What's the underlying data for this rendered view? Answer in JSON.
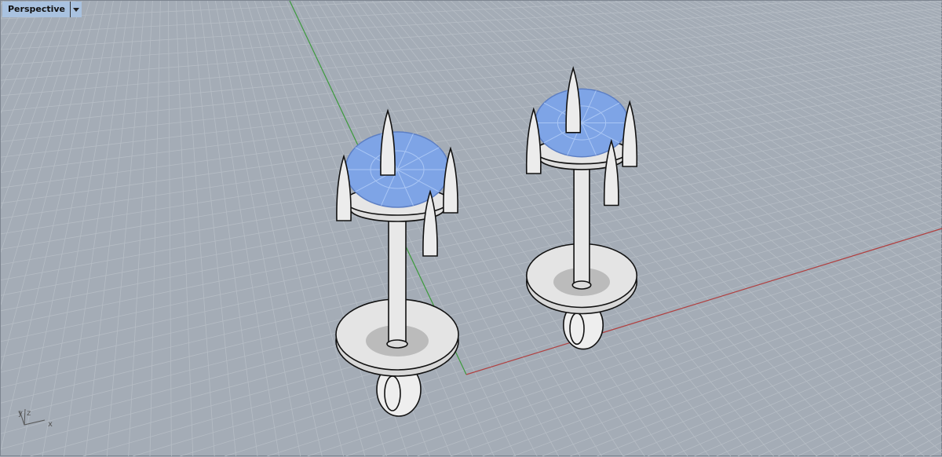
{
  "viewport": {
    "title": "Perspective",
    "menu_icon": "triangle-down-icon",
    "axis_labels": {
      "x": "x",
      "y": "y",
      "z": "z"
    }
  },
  "colors": {
    "background": "#a4acb6",
    "grid": "#b6bdc5",
    "x_axis": "#b04040",
    "y_axis": "#3c9a3c",
    "gem": "#7ea4e6",
    "metal": "#e6e6e6"
  }
}
